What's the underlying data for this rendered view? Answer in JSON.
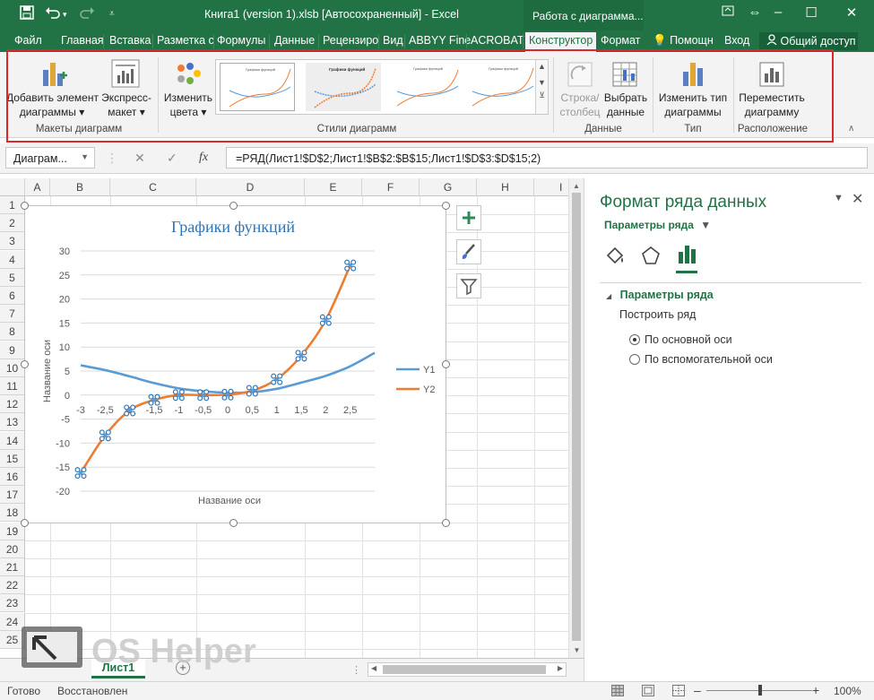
{
  "titlebar": {
    "title": "Книга1 (version 1).xlsb [Автосохраненный] - Excel",
    "context_tab": "Работа с диаграмма..."
  },
  "tabs": [
    "Файл",
    "Главная",
    "Вставка",
    "Разметка с",
    "Формулы",
    "Данные",
    "Рецензиро",
    "Вид",
    "ABBYY Fine",
    "ACROBAT",
    "Конструктор",
    "Формат"
  ],
  "tabs_right": {
    "help": "Помощн",
    "signin": "Вход",
    "share": "Общий доступ"
  },
  "ribbon": {
    "add_element": [
      "Добавить элемент",
      "диаграммы ▾"
    ],
    "express_layout": [
      "Экспресс-",
      "макет ▾"
    ],
    "change_colors": [
      "Изменить",
      "цвета ▾"
    ],
    "switch_row_col": [
      "Строка/",
      "столбец"
    ],
    "select_data": [
      "Выбрать",
      "данные"
    ],
    "change_type": [
      "Изменить тип",
      "диаграммы"
    ],
    "move_chart": [
      "Переместить",
      "диаграмму"
    ],
    "groups": {
      "layouts": "Макеты диаграмм",
      "styles": "Стили диаграмм",
      "data": "Данные",
      "type": "Тип",
      "location": "Расположение"
    },
    "style_thumb_title": "Графики функций"
  },
  "formula_bar": {
    "name_box": "Диаграм...",
    "fx": "fx",
    "formula": "=РЯД(Лист1!$D$2;Лист1!$B$2:$B$15;Лист1!$D$3:$D$15;2)"
  },
  "columns": [
    "A",
    "B",
    "C",
    "D",
    "E",
    "F",
    "G",
    "H",
    "I"
  ],
  "rows": [
    "1",
    "2",
    "3",
    "4",
    "5",
    "6",
    "7",
    "8",
    "9",
    "10",
    "11",
    "12",
    "13",
    "14",
    "15",
    "16",
    "17",
    "18",
    "19",
    "20",
    "21",
    "22",
    "23",
    "24",
    "25"
  ],
  "chart_data": {
    "type": "line",
    "title": "Графики функций",
    "xlabel": "Название оси",
    "ylabel": "Название оси",
    "categories": [
      "-3",
      "-2,5",
      "-2",
      "-1,5",
      "-1",
      "-0,5",
      "0",
      "0,5",
      "1",
      "1,5",
      "2",
      "2,5"
    ],
    "x": [
      -3,
      -2.5,
      -2,
      -1.5,
      -1,
      -0.5,
      0,
      0.5,
      1,
      1.5,
      2,
      2.5,
      3
    ],
    "series": [
      {
        "name": "Y1",
        "color": "#5b9bd5",
        "values": [
          6.2,
          5.2,
          3.9,
          2.5,
          1.4,
          0.8,
          0.5,
          0.6,
          1.3,
          2.6,
          4.0,
          6.0,
          8.8
        ]
      },
      {
        "name": "Y2",
        "color": "#ed7d31",
        "values": [
          -16.2,
          -8.4,
          -3.2,
          -1.0,
          0.0,
          0.0,
          0.1,
          0.9,
          3.3,
          8.2,
          15.6,
          27.0
        ]
      }
    ],
    "selected_series": "Y2",
    "yticks": [
      "30",
      "25",
      "20",
      "15",
      "10",
      "5",
      "0",
      "-5",
      "-10",
      "-15",
      "-20"
    ],
    "ylim": [
      -20,
      30
    ],
    "grid": true,
    "legend": "right"
  },
  "pane": {
    "title": "Формат ряда данных",
    "dropdown": "Параметры ряда",
    "section": "Параметры ряда",
    "plot_on": "Построить ряд",
    "radio_primary": "По основной оси",
    "radio_secondary": "По вспомогательной оси"
  },
  "sheet": {
    "tab": "Лист1"
  },
  "status": {
    "ready": "Готово",
    "restored": "Восстановлен",
    "zoom": "100%"
  },
  "watermark": {
    "text": "OS Helper"
  },
  "colors": {
    "excel_green": "#217346",
    "highlight": "#d9292a",
    "series1": "#5b9bd5",
    "series2": "#ed7d31",
    "chart_title": "#2e75b6"
  }
}
